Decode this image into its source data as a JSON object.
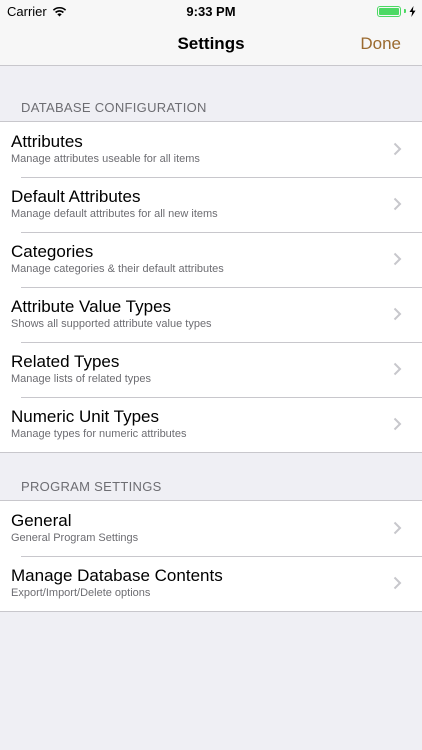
{
  "status_bar": {
    "carrier": "Carrier",
    "time": "9:33 PM"
  },
  "nav": {
    "title": "Settings",
    "done_label": "Done"
  },
  "sections": [
    {
      "header": "DATABASE CONFIGURATION",
      "items": [
        {
          "title": "Attributes",
          "subtitle": "Manage attributes useable for all items"
        },
        {
          "title": "Default Attributes",
          "subtitle": "Manage default attributes for all new items"
        },
        {
          "title": "Categories",
          "subtitle": "Manage categories & their default attributes"
        },
        {
          "title": "Attribute Value Types",
          "subtitle": "Shows all supported attribute value types"
        },
        {
          "title": "Related Types",
          "subtitle": "Manage lists of related types"
        },
        {
          "title": "Numeric Unit Types",
          "subtitle": "Manage types for numeric attributes"
        }
      ]
    },
    {
      "header": "PROGRAM SETTINGS",
      "items": [
        {
          "title": "General",
          "subtitle": "General Program Settings"
        },
        {
          "title": "Manage Database Contents",
          "subtitle": "Export/Import/Delete options"
        }
      ]
    }
  ],
  "colors": {
    "accent": "#9b6a2f",
    "battery": "#4cd964",
    "background": "#efeff4"
  }
}
